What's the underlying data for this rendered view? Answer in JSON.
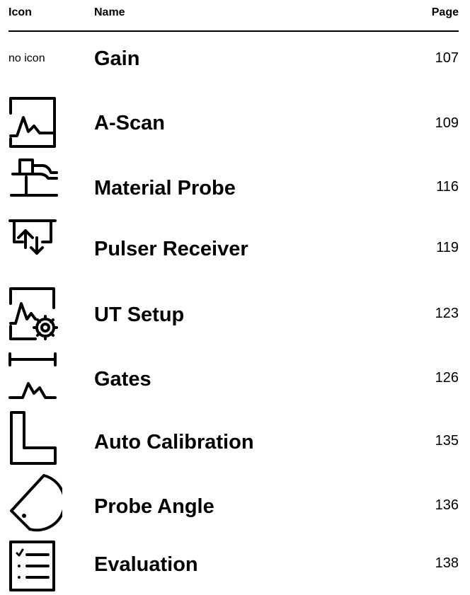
{
  "header": {
    "icon": "Icon",
    "name": "Name",
    "page": "Page"
  },
  "rows": [
    {
      "icon": "none",
      "icon_text": "no icon",
      "name": "Gain",
      "page": "107"
    },
    {
      "icon": "a-scan-icon",
      "name": "A-Scan",
      "page": "109"
    },
    {
      "icon": "material-probe-icon",
      "name": "Material Probe",
      "page": "116"
    },
    {
      "icon": "pulser-receiver-icon",
      "name": "Pulser Receiver",
      "page": "119"
    },
    {
      "icon": "ut-setup-icon",
      "name": "UT Setup",
      "page": "123"
    },
    {
      "icon": "gates-icon",
      "name": "Gates",
      "page": "126"
    },
    {
      "icon": "auto-calibration-icon",
      "name": "Auto Calibration",
      "page": "135"
    },
    {
      "icon": "probe-angle-icon",
      "name": "Probe Angle",
      "page": "136"
    },
    {
      "icon": "evaluation-icon",
      "name": "Evaluation",
      "page": "138"
    }
  ]
}
